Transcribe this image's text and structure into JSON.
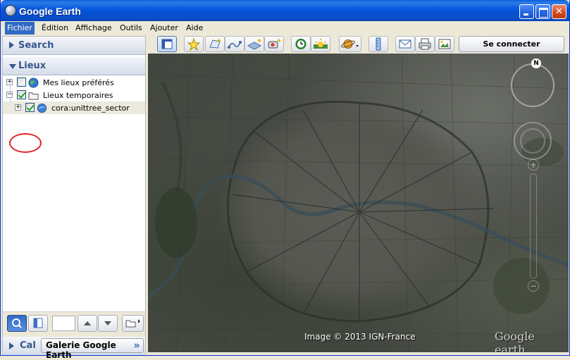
{
  "window": {
    "title": "Google Earth"
  },
  "menu": {
    "items": [
      "Fichier",
      "Édition",
      "Affichage",
      "Outils",
      "Ajouter",
      "Aide"
    ]
  },
  "sidebar": {
    "search_label": "Search",
    "places_label": "Lieux",
    "tree": [
      {
        "label": "Mes lieux préférés",
        "checked": false,
        "icon": "globe-icon"
      },
      {
        "label": "Lieux temporaires",
        "checked": true,
        "icon": "folder-icon"
      },
      {
        "label": "cora:unittree_sector",
        "checked": true,
        "icon": "kml-layer-icon"
      }
    ],
    "layers_label": "Cal",
    "gallery_label": "Galerie Google Earth",
    "gallery_chevron": "»"
  },
  "toolbar": {
    "connect_label": "Se connecter"
  },
  "map": {
    "credit": "Image © 2013 IGN-France",
    "logo": "Google earth",
    "compass_n": "N"
  },
  "colors": {
    "titlebar": "#0550d4",
    "selection": "#316ac5",
    "highlight_ring": "#e0232a"
  }
}
